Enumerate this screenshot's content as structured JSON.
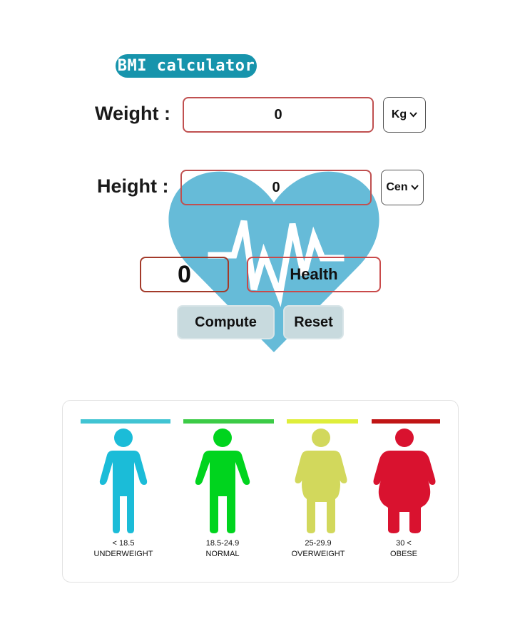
{
  "app": {
    "logo_text": "BMI calculator"
  },
  "form": {
    "weight_label": "Weight :",
    "weight_value": "0",
    "weight_unit": "Kg",
    "height_label": "Height :",
    "height_value": "0",
    "height_unit": "Cen"
  },
  "result": {
    "bmi_value": "0",
    "status_text": "Health"
  },
  "buttons": {
    "compute_label": "Compute",
    "reset_label": "Reset"
  },
  "categories": [
    {
      "range": "< 18.5",
      "name": "UNDERWEIGHT",
      "color": "#1bbcd8",
      "bar_color": "#41c4d3"
    },
    {
      "range": "18.5-24.9",
      "name": "NORMAL",
      "color": "#00d41e",
      "bar_color": "#3ccb46"
    },
    {
      "range": "25-29.9",
      "name": "OVERWEIGHT",
      "color": "#d2d85c",
      "bar_color": "#dfee3a"
    },
    {
      "range": "30 <",
      "name": "OBESE",
      "color": "#d9122f",
      "bar_color": "#c01515"
    }
  ],
  "colors": {
    "heart": "#66bbd8",
    "logo_bg": "#1794ac",
    "field_border": "#c05050",
    "button_bg": "#c8dade"
  }
}
